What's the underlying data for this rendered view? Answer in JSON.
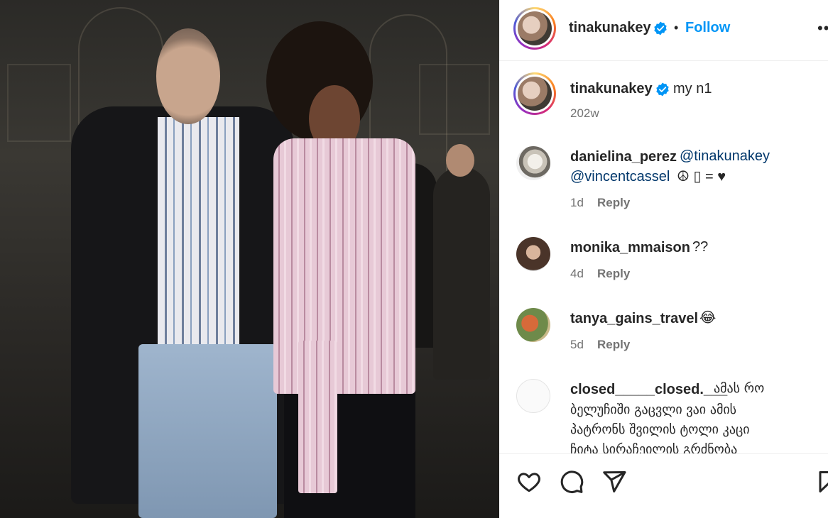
{
  "post": {
    "author": "tinakunakey",
    "follow_label": "Follow",
    "dot": "•",
    "more_label": "•••"
  },
  "caption": {
    "author": "tinakunakey",
    "text": "my n1",
    "age": "202w"
  },
  "comments": [
    {
      "user": "danielina_perez",
      "mention1": "@tinakunakey",
      "mention2": "@vincentcassel",
      "emoji": "☮ ▯ = ♥",
      "age": "1d",
      "reply_label": "Reply"
    },
    {
      "user": "monika_mmaison",
      "text": "??",
      "age": "4d",
      "reply_label": "Reply"
    },
    {
      "user": "tanya_gains_travel",
      "text": "😂",
      "age": "5d",
      "reply_label": "Reply"
    },
    {
      "user": "closed_____closed.___",
      "line1": "ამას რო",
      "line2": "ბელუჩიში გაცვლი ვაი ამის",
      "line3": "პატრონს შვილის ტოლი კაცი",
      "line4": "ჩიტა სირაჩეილის გრძნობა"
    }
  ],
  "icons": {
    "verified": "verified-badge-icon",
    "like": "heart-icon",
    "comment": "comment-icon",
    "share": "share-icon",
    "save": "bookmark-icon"
  },
  "colors": {
    "follow": "#0095f6",
    "verified": "#0095f6",
    "mention": "#00376b",
    "muted": "#737373"
  }
}
